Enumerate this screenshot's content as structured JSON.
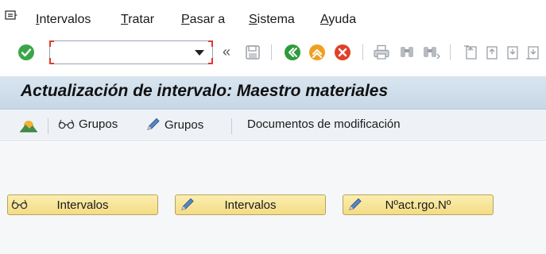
{
  "menubar": {
    "items": [
      {
        "pre": "",
        "u": "I",
        "post": "ntervalos"
      },
      {
        "pre": "",
        "u": "T",
        "post": "ratar"
      },
      {
        "pre": "",
        "u": "P",
        "post": "asar a"
      },
      {
        "pre": "",
        "u": "S",
        "post": "istema"
      },
      {
        "pre": "",
        "u": "A",
        "post": "yuda"
      }
    ]
  },
  "toolbar": {
    "command_field_value": "",
    "icons": [
      "enter-icon",
      "save-icon",
      "back-icon",
      "exit-icon",
      "cancel-icon",
      "print-icon",
      "find-icon",
      "find-next-icon",
      "first-page-icon",
      "previous-page-icon",
      "next-page-icon",
      "last-page-icon"
    ],
    "colors": {
      "enter": "#3aa64a",
      "back": "#2e9b3a",
      "exit": "#f0a020",
      "cancel": "#e0402a"
    }
  },
  "title": "Actualización de intervalo: Maestro materiales",
  "app_toolbar": {
    "items": [
      {
        "icon": "landscape-icon",
        "label": ""
      },
      {
        "icon": "glasses-icon",
        "label": "Grupos"
      },
      {
        "icon": "pencil-icon",
        "label": "Grupos"
      },
      {
        "icon": "",
        "label": "Documentos de modificación"
      }
    ]
  },
  "buttons": [
    {
      "icon": "glasses-icon",
      "label": "Intervalos"
    },
    {
      "icon": "pencil-icon",
      "label": "Intervalos"
    },
    {
      "icon": "pencil-icon",
      "label": "Nºact.rgo.Nº"
    }
  ]
}
